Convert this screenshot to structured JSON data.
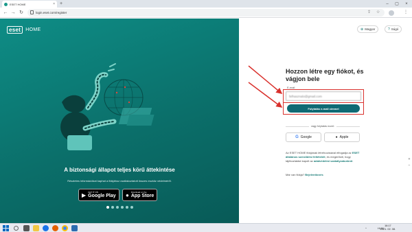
{
  "browser": {
    "tab_title": "ESET HOME",
    "tab_close": "×",
    "new_tab": "+",
    "url": "login.eset.com/register",
    "back": "←",
    "forward": "→",
    "reload": "↻",
    "minimize": "–",
    "maximize": "▢",
    "close": "×",
    "share_icon": "⇪",
    "star_icon": "☆",
    "menu_icon": "⋮"
  },
  "hero": {
    "logo": "eset",
    "product": "HOME",
    "title": "A biztonsági állapot teljes körű áttekintése",
    "subtitle": "Részletes információkat kaphat a fiókjához csatlakoztatott összes eszköz védelméről.",
    "google_play_small": "GET IT ON",
    "google_play_big": "Google Play",
    "app_store_small": "Download on the",
    "app_store_big": "App Store",
    "slides": 6,
    "active_slide": 0
  },
  "panel": {
    "language": "Magyar",
    "help": "Súgó",
    "title": "Hozzon létre egy fiókot, és vágjon bele",
    "email_label": "E-mail",
    "email_value": "felhasznalo@gmail.com",
    "email_button": "Folytatás e-mail címmel",
    "divider": "vagy folytatás ezzel:",
    "google": "Google",
    "apple": "Apple",
    "terms_pre": "Az ESET HOME fiókjának létrehozásával elfogadja az",
    "terms_link1": "ESET általános szerződési feltételeit",
    "terms_mid": ", és megerősíti, hogy tájékoztatást kapott az",
    "terms_link2": "adatvédelmi szabályzatunkról",
    "terms_end": ".",
    "login_prompt": "Már van fiókja?",
    "login_link": "Bejelentkezés"
  },
  "taskbar": {
    "lang": "HUN",
    "time": "16:17",
    "date": "2021. 02. 08.",
    "tray_arrow": "^"
  },
  "colors": {
    "teal": "#0b6f6a",
    "button": "#0f6a74",
    "highlight": "#d9302c",
    "link": "#167a75"
  }
}
